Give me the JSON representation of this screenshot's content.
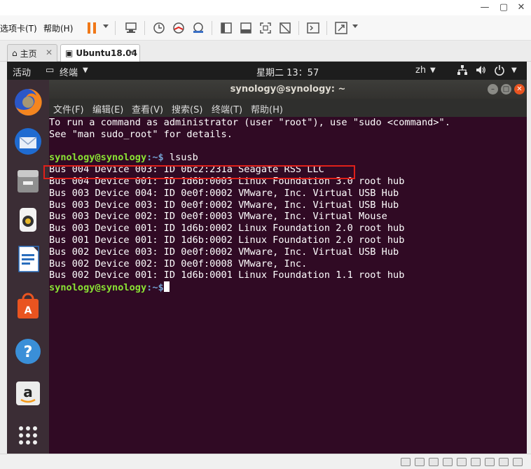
{
  "vmware": {
    "menu": {
      "tabs_label": "选项卡(T)",
      "help_label": "帮助(H)"
    },
    "tabs": [
      {
        "label": "主页"
      },
      {
        "label": "Ubuntu18.04"
      }
    ]
  },
  "ubuntu": {
    "activities_label": "活动",
    "app_menu_label": "终端",
    "clock": "星期二 13：57",
    "language": "zh"
  },
  "terminal": {
    "title": "synology@synology: ~",
    "menu": [
      "文件(F)",
      "编辑(E)",
      "查看(V)",
      "搜索(S)",
      "终端(T)",
      "帮助(H)"
    ],
    "intro_lines": [
      "To run a command as administrator (user \"root\"), use \"sudo <command>\".",
      "See \"man sudo_root\" for details."
    ],
    "prompt_user": "synology@synology",
    "prompt_path": ":~$",
    "command": " lsusb",
    "output_lines": [
      "Bus 004 Device 003: ID 0bc2:231a Seagate RSS LLC",
      "Bus 004 Device 001: ID 1d6b:0003 Linux Foundation 3.0 root hub",
      "Bus 003 Device 004: ID 0e0f:0002 VMware, Inc. Virtual USB Hub",
      "Bus 003 Device 003: ID 0e0f:0002 VMware, Inc. Virtual USB Hub",
      "Bus 003 Device 002: ID 0e0f:0003 VMware, Inc. Virtual Mouse",
      "Bus 003 Device 001: ID 1d6b:0002 Linux Foundation 2.0 root hub",
      "Bus 001 Device 001: ID 1d6b:0002 Linux Foundation 2.0 root hub",
      "Bus 002 Device 003: ID 0e0f:0002 VMware, Inc. Virtual USB Hub",
      "Bus 002 Device 002: ID 0e0f:0008 VMware, Inc.",
      "Bus 002 Device 001: ID 1d6b:0001 Linux Foundation 1.1 root hub"
    ]
  },
  "dock": {
    "items": [
      "firefox-icon",
      "thunderbird-icon",
      "files-icon",
      "rhythmbox-icon",
      "libreoffice-writer-icon",
      "ubuntu-software-icon",
      "help-icon",
      "amazon-icon",
      "show-applications-icon"
    ]
  },
  "colors": {
    "terminal_bg": "#300a24",
    "prompt_user": "#8ae234",
    "prompt_path": "#729fcf",
    "highlight": "#e0201a",
    "pause_orange": "#f07818"
  }
}
